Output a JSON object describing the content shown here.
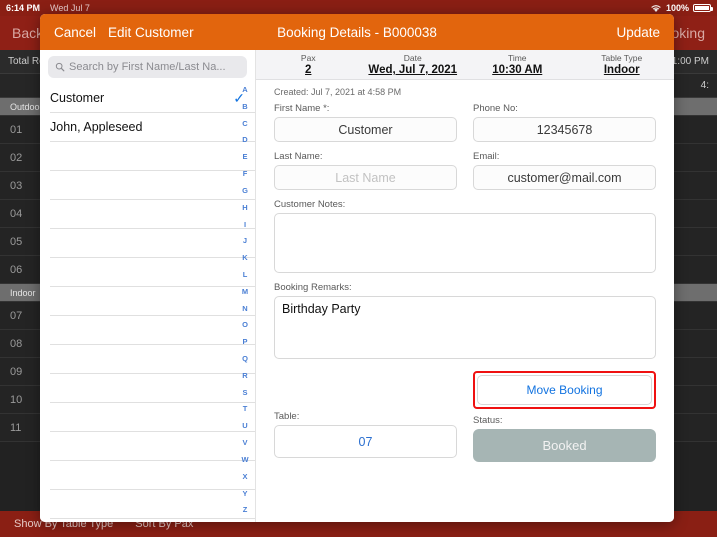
{
  "statusbar": {
    "time": "6:14 PM",
    "date": "Wed Jul 7",
    "battery_pct": "100%",
    "wifi_icon": "wifi-icon",
    "battery_icon": "battery-full-icon"
  },
  "background": {
    "back_label": "Back",
    "new_booking_label": "New Booking",
    "total_reservations_label": "Total Reservations",
    "timeline_right": "1:00 PM",
    "timeline_second": "4:",
    "bottom_bar": {
      "show_by_label": "Show By Table Type",
      "sort_by_label": "Sort By Pax"
    },
    "table_rows": [
      {
        "label": "Outdoor",
        "group": true
      },
      {
        "label": "01",
        "group": false
      },
      {
        "label": "02",
        "group": false
      },
      {
        "label": "03",
        "group": false
      },
      {
        "label": "04",
        "group": false
      },
      {
        "label": "05",
        "group": false
      },
      {
        "label": "06",
        "group": false
      },
      {
        "label": "Indoor",
        "group": true
      },
      {
        "label": "07",
        "group": false
      },
      {
        "label": "08",
        "group": false
      },
      {
        "label": "09",
        "group": false
      },
      {
        "label": "10",
        "group": false
      },
      {
        "label": "11",
        "group": false
      }
    ]
  },
  "modal": {
    "header": {
      "cancel_label": "Cancel",
      "edit_customer_label": "Edit Customer",
      "title": "Booking Details - B000038",
      "update_label": "Update",
      "bg_color": "#e2650d"
    },
    "picker": {
      "search_placeholder": "Search by First Name/Last Na...",
      "search_value": "",
      "customers": [
        {
          "name": "Customer",
          "selected": true
        },
        {
          "name": "John, Appleseed",
          "selected": false
        }
      ],
      "alpha_index": [
        "A",
        "B",
        "C",
        "D",
        "E",
        "F",
        "G",
        "H",
        "I",
        "J",
        "K",
        "L",
        "M",
        "N",
        "O",
        "P",
        "Q",
        "R",
        "S",
        "T",
        "U",
        "V",
        "W",
        "X",
        "Y",
        "Z"
      ]
    },
    "summary": [
      {
        "label": "Pax",
        "value": "2"
      },
      {
        "label": "Date",
        "value": "Wed, Jul 7, 2021"
      },
      {
        "label": "Time",
        "value": "10:30 AM"
      },
      {
        "label": "Table Type",
        "value": "Indoor"
      }
    ],
    "created_text": "Created: Jul 7, 2021 at 4:58 PM",
    "fields": {
      "first_name": {
        "label": "First Name *:",
        "value": "Customer",
        "placeholder": "First Name"
      },
      "phone_no": {
        "label": "Phone No:",
        "value": "12345678",
        "placeholder": "Phone No"
      },
      "last_name": {
        "label": "Last Name:",
        "value": "",
        "placeholder": "Last Name"
      },
      "email": {
        "label": "Email:",
        "value": "customer@mail.com",
        "placeholder": "Email"
      },
      "customer_notes": {
        "label": "Customer Notes:",
        "value": "",
        "placeholder": ""
      },
      "booking_remarks": {
        "label": "Booking Remarks:",
        "value": "Birthday Party",
        "placeholder": ""
      },
      "table": {
        "label": "Table:",
        "value": "07"
      },
      "status": {
        "label": "Status:",
        "value": "Booked"
      }
    },
    "move_booking": {
      "label": "Move Booking",
      "highlight_color": "#ef1111",
      "text_color": "#1273e0"
    }
  }
}
